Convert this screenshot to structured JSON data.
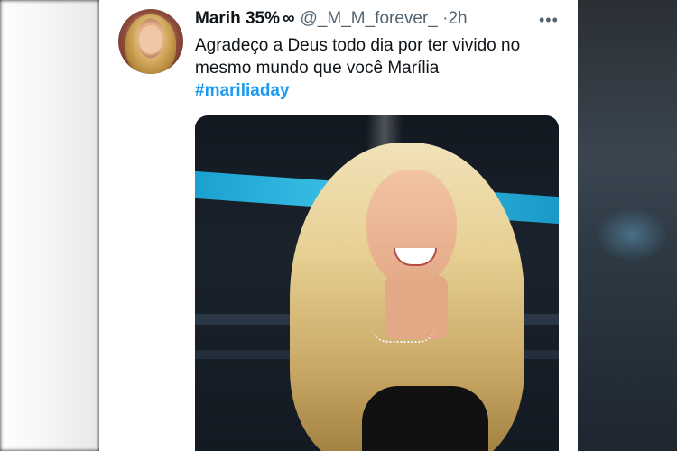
{
  "tweet": {
    "name": "Marih 35%",
    "infinity": "∞",
    "handle": "@_M_M_forever_",
    "dot": "·",
    "time": "2h",
    "more": "•••",
    "text": "Agradeço a Deus todo dia por ter vivido no mesmo mundo que você Marília",
    "hashtag": "#mariliaday"
  },
  "colors": {
    "hashtag": "#1d9bf0",
    "secondary_text": "#536471",
    "primary_text": "#0f1419"
  }
}
